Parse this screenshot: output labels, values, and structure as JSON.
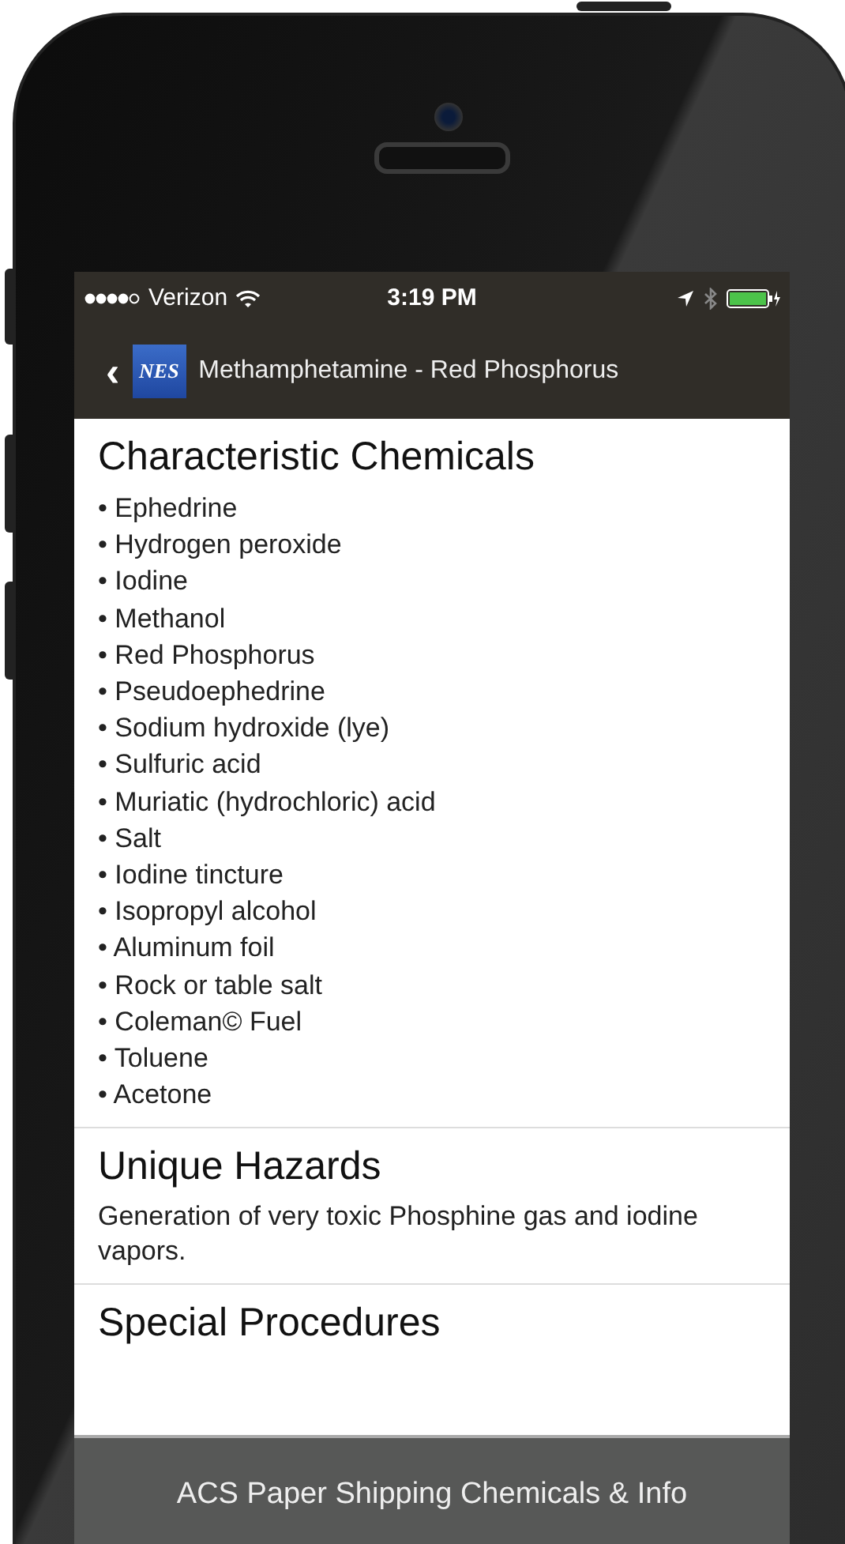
{
  "status_bar": {
    "carrier": "Verizon",
    "time": "3:19 PM"
  },
  "nav_bar": {
    "back": "‹",
    "logo": "NES",
    "title": "Methamphetamine - Red Phosphorus"
  },
  "sections": [
    {
      "title": "Characteristic Chemicals",
      "kind": "list",
      "items": [
        "• Ephedrine",
        "• Hydrogen peroxide",
        "• Iodine",
        "• Methanol",
        "• Red Phosphorus",
        "• Pseudoephedrine",
        "• Sodium hydroxide (lye)",
        "• Sulfuric acid",
        "• Muriatic (hydrochloric) acid",
        "• Salt",
        "• Iodine tincture",
        "• Isopropyl alcohol",
        "• Aluminum foil",
        "• Rock or table salt",
        "• Coleman© Fuel",
        "• Toluene",
        "• Acetone"
      ]
    },
    {
      "title": "Unique Hazards",
      "kind": "text",
      "text": "Generation of very toxic Phosphine gas and iodine vapors."
    },
    {
      "title": "Special Procedures",
      "kind": "text"
    }
  ],
  "bottom_bar": {
    "label": "ACS Paper Shipping Chemicals & Info"
  }
}
